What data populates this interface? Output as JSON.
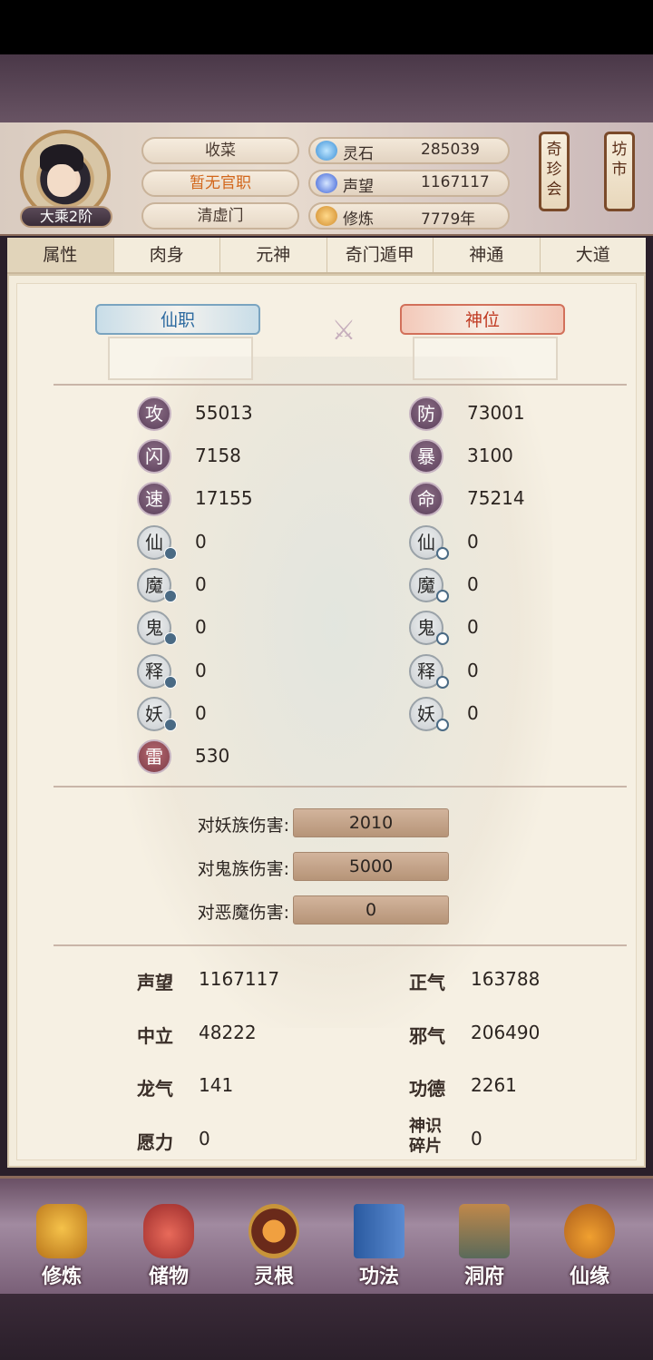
{
  "header": {
    "rank": "大乘2阶",
    "pills": [
      "收菜",
      "暂无官职",
      "清虚门"
    ],
    "resources": [
      {
        "label": "灵石",
        "value": "285039",
        "icon": "gem-icon"
      },
      {
        "label": "声望",
        "value": "1167117",
        "icon": "flame-icon"
      },
      {
        "label": "修炼",
        "value": "7779年",
        "icon": "meditation-icon"
      }
    ],
    "scroll_buttons": [
      "奇珍会",
      "坊市"
    ]
  },
  "tabs": [
    "属性",
    "肉身",
    "元神",
    "奇门遁甲",
    "神通",
    "大道"
  ],
  "titles": {
    "left": "仙职",
    "right": "神位"
  },
  "stats_left": [
    {
      "label": "攻",
      "value": "55013"
    },
    {
      "label": "闪",
      "value": "7158"
    },
    {
      "label": "速",
      "value": "17155"
    },
    {
      "label": "仙",
      "value": "0"
    },
    {
      "label": "魔",
      "value": "0"
    },
    {
      "label": "鬼",
      "value": "0"
    },
    {
      "label": "释",
      "value": "0"
    },
    {
      "label": "妖",
      "value": "0"
    },
    {
      "label": "雷",
      "value": "530"
    }
  ],
  "stats_right": [
    {
      "label": "防",
      "value": "73001"
    },
    {
      "label": "暴",
      "value": "3100"
    },
    {
      "label": "命",
      "value": "75214"
    },
    {
      "label": "仙",
      "value": "0"
    },
    {
      "label": "魔",
      "value": "0"
    },
    {
      "label": "鬼",
      "value": "0"
    },
    {
      "label": "释",
      "value": "0"
    },
    {
      "label": "妖",
      "value": "0"
    }
  ],
  "damage": [
    {
      "label": "对妖族伤害:",
      "value": "2010"
    },
    {
      "label": "对鬼族伤害:",
      "value": "5000"
    },
    {
      "label": "对恶魔伤害:",
      "value": "0"
    }
  ],
  "misc_left": [
    {
      "label": "声望",
      "value": "1167117"
    },
    {
      "label": "中立",
      "value": "48222"
    },
    {
      "label": "龙气",
      "value": "141"
    },
    {
      "label": "愿力",
      "value": "0"
    }
  ],
  "misc_right": [
    {
      "label": "正气",
      "value": "163788"
    },
    {
      "label": "邪气",
      "value": "206490"
    },
    {
      "label": "功德",
      "value": "2261"
    },
    {
      "label": "神识碎片",
      "value": "0"
    }
  ],
  "nav": [
    {
      "label": "修炼",
      "icon": "monk-icon"
    },
    {
      "label": "储物",
      "icon": "bag-icon"
    },
    {
      "label": "灵根",
      "icon": "orb-icon"
    },
    {
      "label": "功法",
      "icon": "book-icon"
    },
    {
      "label": "洞府",
      "icon": "house-icon"
    },
    {
      "label": "仙缘",
      "icon": "gourd-icon"
    }
  ]
}
